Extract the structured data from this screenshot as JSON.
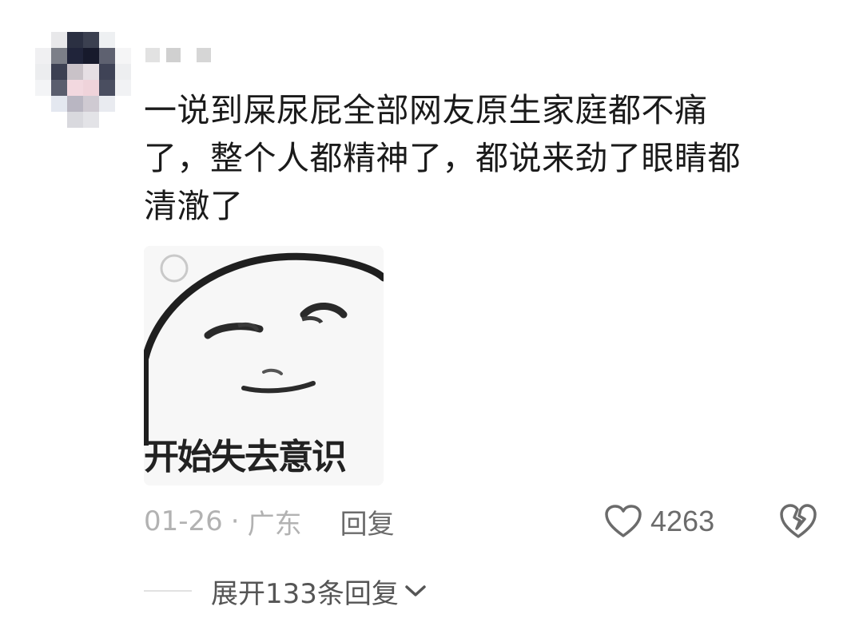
{
  "comment": {
    "text_lines": [
      "一说到屎尿屁全部网友原生家庭都不痛",
      "了，整个人都精神了，都说来劲了眼睛都",
      "清澈了"
    ]
  },
  "meme": {
    "caption": "开始失去意识"
  },
  "meta": {
    "date": "01-26",
    "separator": "·",
    "location": "广东",
    "reply_label": "回复"
  },
  "like": {
    "icon": "heart-outline-icon",
    "count": "4263"
  },
  "dislike": {
    "icon": "broken-heart-icon"
  },
  "expand": {
    "label": "展开133条回复",
    "icon": "chevron-down-icon"
  },
  "colors": {
    "text_primary": "#1a1a1a",
    "text_secondary": "#a8a8a8",
    "icon_gray": "#6b6b6b"
  }
}
